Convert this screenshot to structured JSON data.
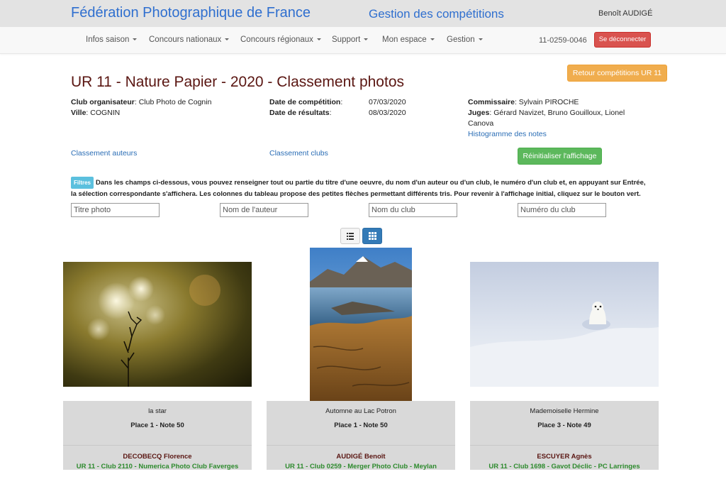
{
  "header": {
    "site_title": "Fédération Photographique de France",
    "app_title": "Gestion des compétitions",
    "user_name": "Benoît AUDIGÉ"
  },
  "nav": {
    "items": [
      {
        "label": "Infos saison"
      },
      {
        "label": "Concours nationaux"
      },
      {
        "label": "Concours régionaux"
      },
      {
        "label": "Support"
      },
      {
        "label": "Mon espace"
      },
      {
        "label": "Gestion"
      }
    ],
    "user_code": "11-0259-0046",
    "logout_label": "Se déconnecter"
  },
  "page": {
    "return_label": "Retour compétitions UR 11",
    "title": "UR 11 - Nature Papier - 2020 - Classement photos"
  },
  "info": {
    "club_org_label": "Club organisateur",
    "club_org_value": "Club Photo de Cognin",
    "ville_label": "Ville",
    "ville_value": "COGNIN",
    "date_comp_label": "Date de compétition",
    "date_comp_value": "07/03/2020",
    "date_res_label": "Date de résultats",
    "date_res_value": "08/03/2020",
    "commissaire_label": "Commissaire",
    "commissaire_value": "Sylvain PIROCHE",
    "juges_label": "Juges",
    "juges_value": "Gérard Navizet, Bruno Gouilloux, Lionel Canova",
    "histogram_link": "Histogramme des notes",
    "classement_auteurs": "Classement auteurs",
    "classement_clubs": "Classement clubs",
    "reset_label": "Réinitialiser l'affichage"
  },
  "filters": {
    "badge": "Filtres",
    "help_text": "Dans les champs ci-dessous, vous pouvez renseigner tout ou partie du titre d'une oeuvre, du nom d'un auteur ou d'un club, le numéro d'un club et, en appuyant sur Entrée, la sélection correspondante s'affichera. Les colonnes du tableau propose des petites flèches permettant différents tris. Pour revenir à l'affichage initial, cliquez sur le bouton vert.",
    "inputs": [
      {
        "placeholder": "Titre photo",
        "value": ""
      },
      {
        "placeholder": "Nom de l'auteur",
        "value": ""
      },
      {
        "placeholder": "Nom du club",
        "value": ""
      },
      {
        "placeholder": "Numéro du club",
        "value": ""
      }
    ]
  },
  "view_toggle": {
    "list_icon": "list-icon",
    "grid_icon": "grid-icon",
    "active": "grid"
  },
  "photos": [
    {
      "title": "la star",
      "place": "Place 1 - Note 50",
      "author": "DECOBECQ Florence",
      "club": "UR 11 - Club 2110 - Numerica Photo Club Faverges"
    },
    {
      "title": "Automne au Lac Potron",
      "place": "Place 1 - Note 50",
      "author": "AUDIGÉ Benoît",
      "club": "UR 11 - Club 0259 - Merger Photo Club - Meylan"
    },
    {
      "title": "Mademoiselle Hermine",
      "place": "Place 3 - Note 49",
      "author": "ESCUYER Agnès",
      "club": "UR 11 - Club 1698 - Gavot Déclic - PC Larringes"
    }
  ],
  "colors": {
    "brand_blue": "#2f6fcf",
    "title_maroon": "#5a1612",
    "danger": "#d9534f",
    "warning": "#f0ad4e",
    "success": "#5cb85c",
    "club_green": "#2e8b2e"
  }
}
